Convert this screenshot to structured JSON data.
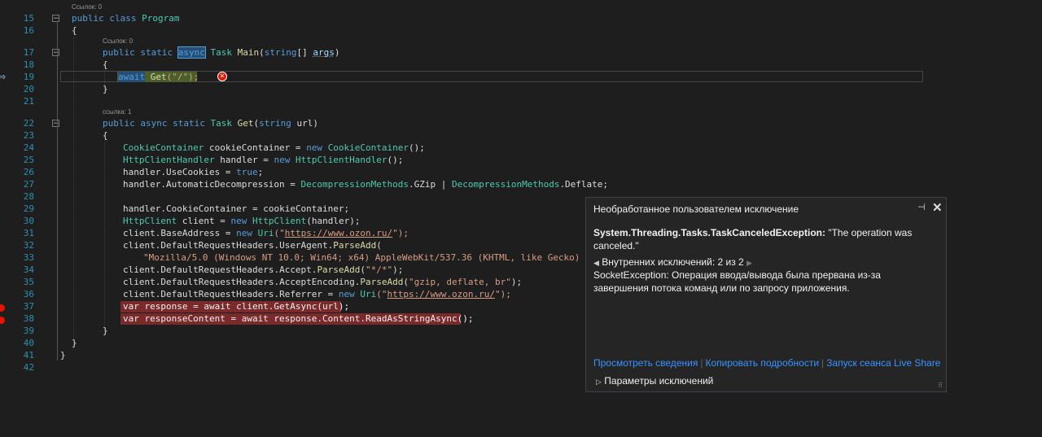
{
  "code_lens": {
    "program": "Ссылок: 0",
    "main": "Ссылок: 0",
    "get": "ссылка: 1"
  },
  "line_numbers": [
    "15",
    "16",
    "17",
    "18",
    "19",
    "20",
    "21",
    "22",
    "23",
    "24",
    "25",
    "26",
    "27",
    "28",
    "29",
    "30",
    "31",
    "32",
    "33",
    "34",
    "35",
    "36",
    "37",
    "38",
    "39",
    "40",
    "41",
    "42"
  ],
  "code": {
    "l15": [
      "public",
      "class",
      "Program"
    ],
    "l16": "{",
    "l17": [
      "public",
      "static",
      "async",
      "Task",
      "Main",
      "(",
      "string",
      "[] ",
      "args",
      ")"
    ],
    "l18": "{",
    "l19": [
      "await",
      "Get",
      "(\"/\");"
    ],
    "l20": "}",
    "l22": [
      "public",
      "async",
      "static",
      "Task",
      "Get",
      "(",
      "string",
      " url)"
    ],
    "l23": "{",
    "l24": [
      "CookieContainer",
      "cookieContainer",
      " = ",
      "new",
      "CookieContainer",
      "();"
    ],
    "l25": [
      "HttpClientHandler",
      "handler",
      " = ",
      "new",
      "HttpClientHandler",
      "();"
    ],
    "l26": [
      "handler",
      ".UseCookies = ",
      "true",
      ";"
    ],
    "l27": [
      "handler",
      ".AutomaticDecompression = ",
      "DecompressionMethods",
      ".GZip | ",
      "DecompressionMethods",
      ".Deflate;"
    ],
    "l29": [
      "handler",
      ".CookieContainer = ",
      "cookieContainer",
      ";"
    ],
    "l30": [
      "HttpClient",
      "client",
      " = ",
      "new",
      "HttpClient",
      "(handler);"
    ],
    "l31": [
      "client",
      ".BaseAddress = ",
      "new",
      "Uri",
      "(\"",
      "https://www.ozon.ru/",
      "\");"
    ],
    "l32": [
      "client",
      ".DefaultRequestHeaders.UserAgent.",
      "ParseAdd",
      "("
    ],
    "l33": "\"Mozilla/5.0 (Windows NT 10.0; Win64; x64) AppleWebKit/537.36 (KHTML, like Gecko) Chr",
    "l34": [
      "client",
      ".DefaultRequestHeaders.Accept.",
      "ParseAdd",
      "(",
      "\"*/*\"",
      ");"
    ],
    "l35": [
      "client",
      ".DefaultRequestHeaders.AcceptEncoding.",
      "ParseAdd",
      "(",
      "\"gzip, deflate, br\"",
      ");"
    ],
    "l36": [
      "client",
      ".DefaultRequestHeaders.Referrer = ",
      "new",
      "Uri",
      "(\"",
      "https://www.ozon.ru/",
      "\");"
    ],
    "l37": "var response = await client.GetAsync(url);",
    "l38": "var responseContent = await response.Content.ReadAsStringAsync();",
    "l39": "}",
    "l40": "}",
    "l41": "}"
  },
  "exception_panel": {
    "title": "Необработанное пользователем исключение",
    "pin_icon": "⊣",
    "close_icon": "✕",
    "exception_type": "System.Threading.Tasks.TaskCanceledException:",
    "exception_message": " \"The operation was canceled.\"",
    "inner_label": "Внутренних исключений: 2 из 2",
    "inner_message": "SocketException: Операция ввода/вывода была прервана из-за завершения потока команд или по запросу приложения.",
    "links": [
      "Просмотреть сведения",
      "Копировать подробности",
      "Запуск сеанса Live Share"
    ],
    "settings_label": "Параметры исключений"
  },
  "colors": {
    "background": "#1e1e1e",
    "keyword": "#569cd6",
    "type": "#4ec9b0",
    "method": "#dcdcaa",
    "string": "#d69d85",
    "variable": "#9cdcfe",
    "line_number": "#2b91af",
    "breakpoint": "#e51400",
    "link": "#3794ff"
  }
}
